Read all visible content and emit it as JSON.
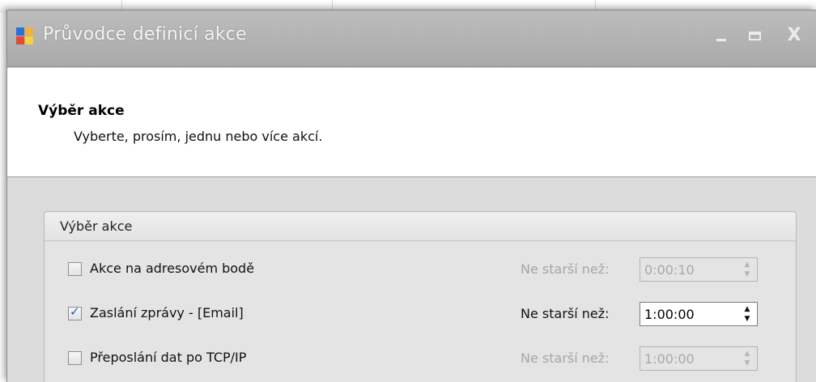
{
  "window": {
    "title": "Průvodce definicí akce",
    "controls": {
      "minimize": "_",
      "close": "X"
    },
    "icon": "app-window-icon"
  },
  "header": {
    "title": "Výběr akce",
    "subtitle": "Vyberte, prosím, jednu nebo více akcí."
  },
  "group": {
    "title": "Výběr akce",
    "rows": [
      {
        "label": "Akce na adresovém bodě",
        "checked": false,
        "checkmark": "",
        "age_label": "Ne starší než:",
        "age_value": "0:00:10",
        "enabled": false
      },
      {
        "label": "Zaslání zprávy - [Email]",
        "checked": true,
        "checkmark": "✓",
        "age_label": "Ne starší než:",
        "age_value": "1:00:00",
        "enabled": true
      },
      {
        "label": "Přeposlání dat po TCP/IP",
        "checked": false,
        "checkmark": "",
        "age_label": "Ne starší než:",
        "age_value": "1:00:00",
        "enabled": false
      }
    ]
  },
  "spinner_glyphs": {
    "up": "▲",
    "down": "▼"
  },
  "colors": {
    "titlebar": "#b3b3b3",
    "checkmark": "#2458c7",
    "disabled_text": "#a6a6a6"
  }
}
